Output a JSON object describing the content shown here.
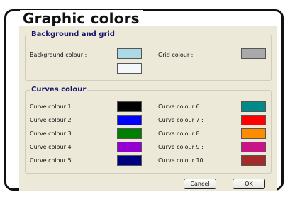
{
  "window": {
    "title": "Graphic colors"
  },
  "background_grid": {
    "legend": "Background and grid",
    "background_label": "Background colour :",
    "grid_label": "Grid colour :",
    "background_color": "#add8e6",
    "background_color_2": "#f5f8fb",
    "grid_color": "#a9a9a9"
  },
  "curves": {
    "legend": "Curves colour",
    "items": [
      {
        "label": "Curve colour 1 :",
        "color": "#000000"
      },
      {
        "label": "Curve colour 2 :",
        "color": "#0000ff"
      },
      {
        "label": "Curve colour 3 :",
        "color": "#008000"
      },
      {
        "label": "Curve colour 4 :",
        "color": "#9400d3"
      },
      {
        "label": "Curve colour 5 :",
        "color": "#000080"
      },
      {
        "label": "Curve colour 6 :",
        "color": "#008b8b"
      },
      {
        "label": "Curve colour 7 :",
        "color": "#ff0000"
      },
      {
        "label": "Curve colour 8 :",
        "color": "#ff8c00"
      },
      {
        "label": "Curve colour 9 :",
        "color": "#c71585"
      },
      {
        "label": "Curve colour 10 :",
        "color": "#a52a2a"
      }
    ]
  },
  "buttons": {
    "cancel": "Cancel",
    "ok": "OK"
  }
}
